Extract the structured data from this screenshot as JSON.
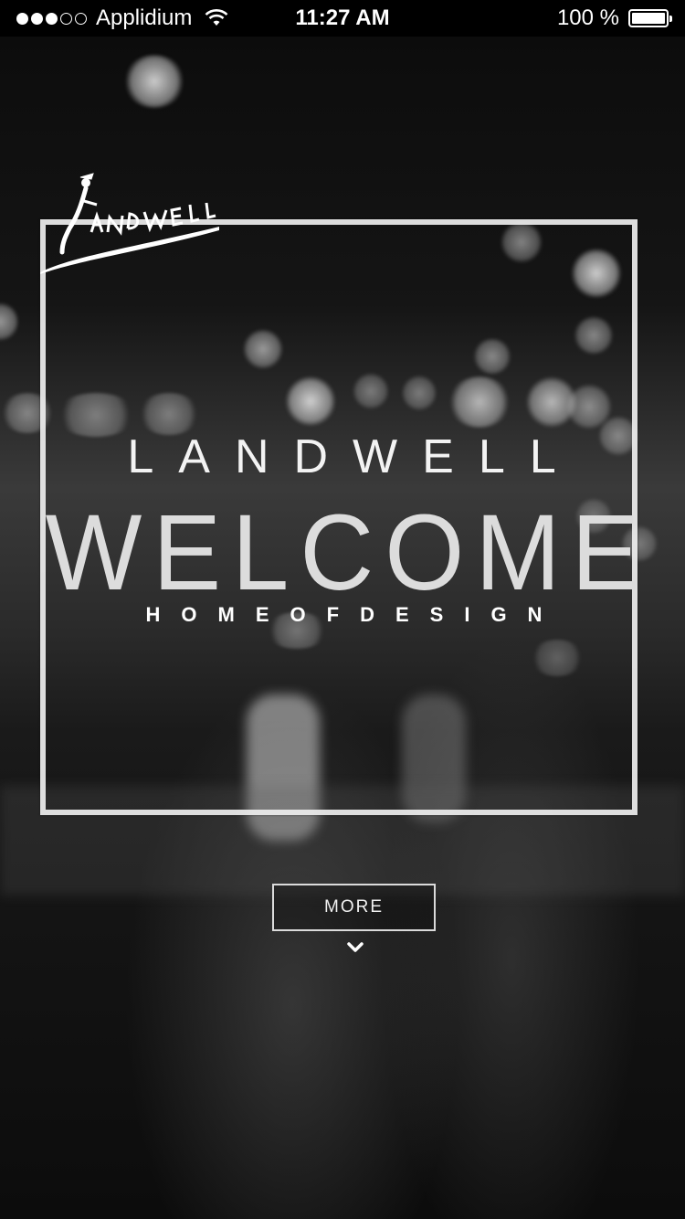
{
  "status_bar": {
    "carrier": "Applidium",
    "time": "11:27 AM",
    "battery": "100 %",
    "signal_bars_filled": 3,
    "signal_bars_total": 5
  },
  "logo": {
    "text": "LANDWELL"
  },
  "hero": {
    "brand": "LANDWELL",
    "headline": "WELCOME",
    "tagline": "HOMEOFDESIGN"
  },
  "cta": {
    "more_label": "MORE"
  },
  "icons": {
    "wifi": "wifi-icon",
    "battery": "battery-icon",
    "chevron": "chevron-down-icon"
  },
  "colors": {
    "status_bar_bg": "#000000",
    "text_primary": "#f3f3f3",
    "headline": "#dcdcdc"
  }
}
